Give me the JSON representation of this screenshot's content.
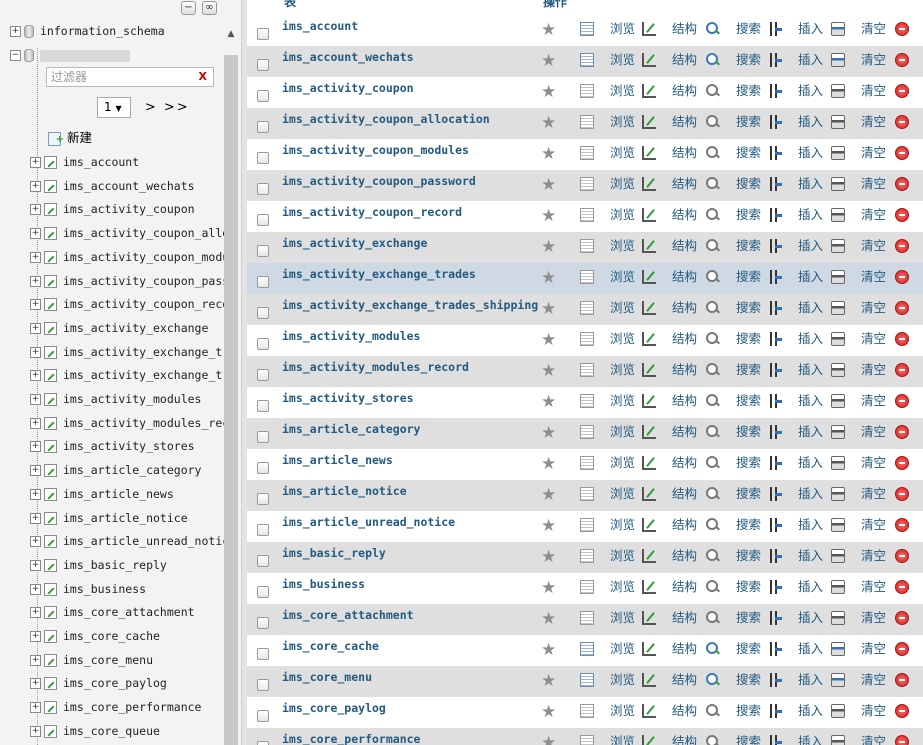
{
  "nav": {
    "top_controls": [
      "−",
      "∞"
    ],
    "databases": [
      {
        "expander": "+",
        "label": "information_schema"
      },
      {
        "expander": "−",
        "label": ""
      }
    ],
    "filter_placeholder": "过滤器",
    "filter_clear": "X",
    "pager": {
      "page": "1",
      "next": "> >>"
    },
    "new_label": "新建",
    "tables": [
      "ims_account",
      "ims_account_wechats",
      "ims_activity_coupon",
      "ims_activity_coupon_allocation",
      "ims_activity_coupon_modules",
      "ims_activity_coupon_password",
      "ims_activity_coupon_record",
      "ims_activity_exchange",
      "ims_activity_exchange_trades",
      "ims_activity_exchange_trades_shipping",
      "ims_activity_modules",
      "ims_activity_modules_record",
      "ims_activity_stores",
      "ims_article_category",
      "ims_article_news",
      "ims_article_notice",
      "ims_article_unread_notice",
      "ims_basic_reply",
      "ims_business",
      "ims_core_attachment",
      "ims_core_cache",
      "ims_core_menu",
      "ims_core_paylog",
      "ims_core_performance",
      "ims_core_queue"
    ]
  },
  "table_header": {
    "table": "表",
    "actions": "操作"
  },
  "actions": {
    "browse": "浏览",
    "structure": "结构",
    "search": "搜索",
    "insert": "插入",
    "empty": "清空"
  },
  "rows": [
    {
      "name": "ims_account",
      "active": true
    },
    {
      "name": "ims_account_wechats",
      "active": true
    },
    {
      "name": "ims_activity_coupon",
      "active": false
    },
    {
      "name": "ims_activity_coupon_allocation",
      "active": false
    },
    {
      "name": "ims_activity_coupon_modules",
      "active": false
    },
    {
      "name": "ims_activity_coupon_password",
      "active": false
    },
    {
      "name": "ims_activity_coupon_record",
      "active": false
    },
    {
      "name": "ims_activity_exchange",
      "active": false
    },
    {
      "name": "ims_activity_exchange_trades",
      "active": false
    },
    {
      "name": "ims_activity_exchange_trades_shipping",
      "active": false
    },
    {
      "name": "ims_activity_modules",
      "active": false
    },
    {
      "name": "ims_activity_modules_record",
      "active": false
    },
    {
      "name": "ims_activity_stores",
      "active": false
    },
    {
      "name": "ims_article_category",
      "active": false
    },
    {
      "name": "ims_article_news",
      "active": false
    },
    {
      "name": "ims_article_notice",
      "active": false
    },
    {
      "name": "ims_article_unread_notice",
      "active": false
    },
    {
      "name": "ims_basic_reply",
      "active": false
    },
    {
      "name": "ims_business",
      "active": false
    },
    {
      "name": "ims_core_attachment",
      "active": false
    },
    {
      "name": "ims_core_cache",
      "active": true
    },
    {
      "name": "ims_core_menu",
      "active": true
    },
    {
      "name": "ims_core_paylog",
      "active": false
    },
    {
      "name": "ims_core_performance",
      "active": false
    }
  ],
  "hover_row": "ims_activity_exchange_trades"
}
